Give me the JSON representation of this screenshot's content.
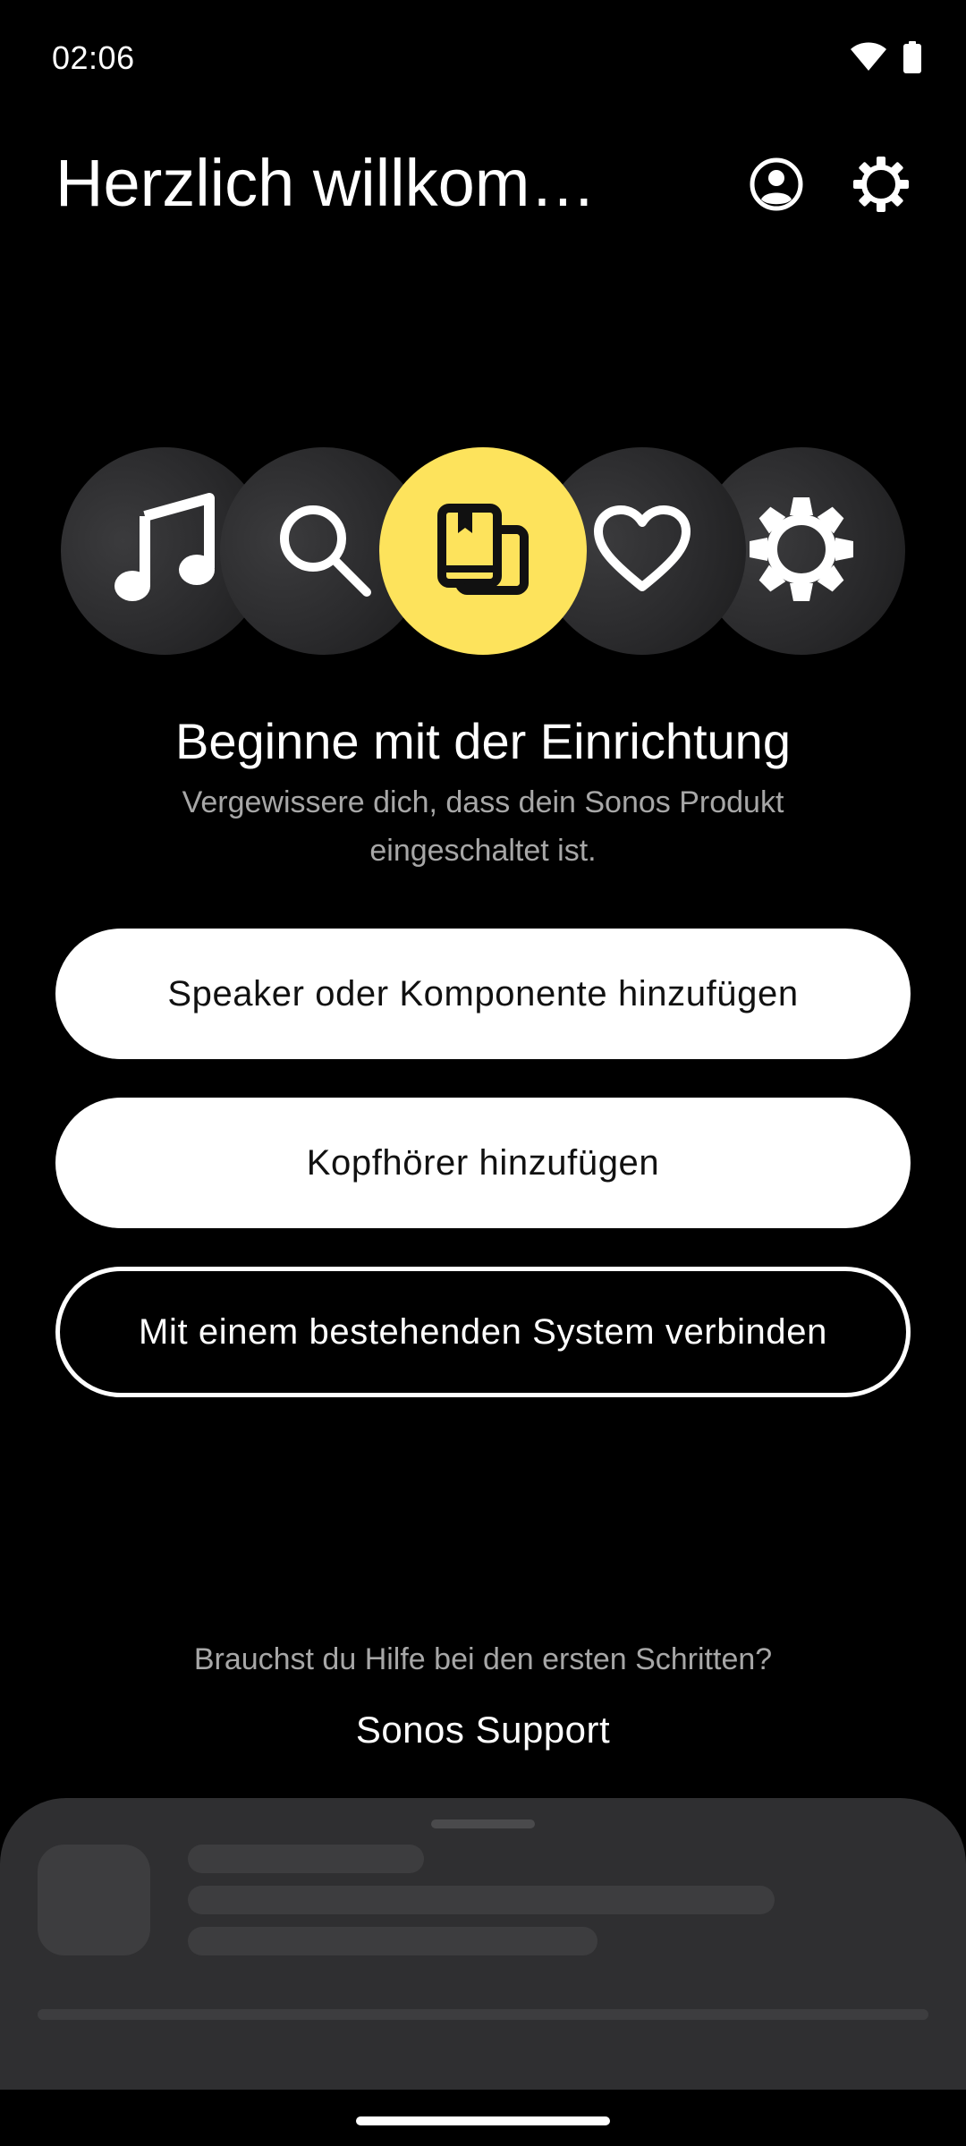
{
  "status_bar": {
    "time": "02:06",
    "icons": [
      "wifi-icon",
      "battery-icon"
    ]
  },
  "header": {
    "title": "Herzlich willkom…",
    "account_icon": "account-circle-icon",
    "settings_icon": "gear-icon"
  },
  "carousel": {
    "items": [
      {
        "icon": "music-note-icon",
        "active": false
      },
      {
        "icon": "search-icon",
        "active": false
      },
      {
        "icon": "library-icon",
        "active": true
      },
      {
        "icon": "heart-icon",
        "active": false
      },
      {
        "icon": "gear-icon",
        "active": false
      }
    ],
    "active_color": "#fde35c"
  },
  "intro": {
    "headline": "Beginne mit der Einrichtung",
    "subtext": "Vergewissere dich, dass dein Sonos Produkt eingeschaltet ist."
  },
  "actions": {
    "add_speaker": "Speaker oder Komponente hinzufügen",
    "add_headphones": "Kopfhörer hinzufügen",
    "connect_existing": "Mit einem bestehenden System verbinden"
  },
  "help": {
    "question": "Brauchst du Hilfe bei den ersten Schritten?",
    "link": "Sonos Support"
  },
  "colors": {
    "background": "#000000",
    "sheet": "#2f2f31",
    "muted_text": "#a7a7a7"
  }
}
